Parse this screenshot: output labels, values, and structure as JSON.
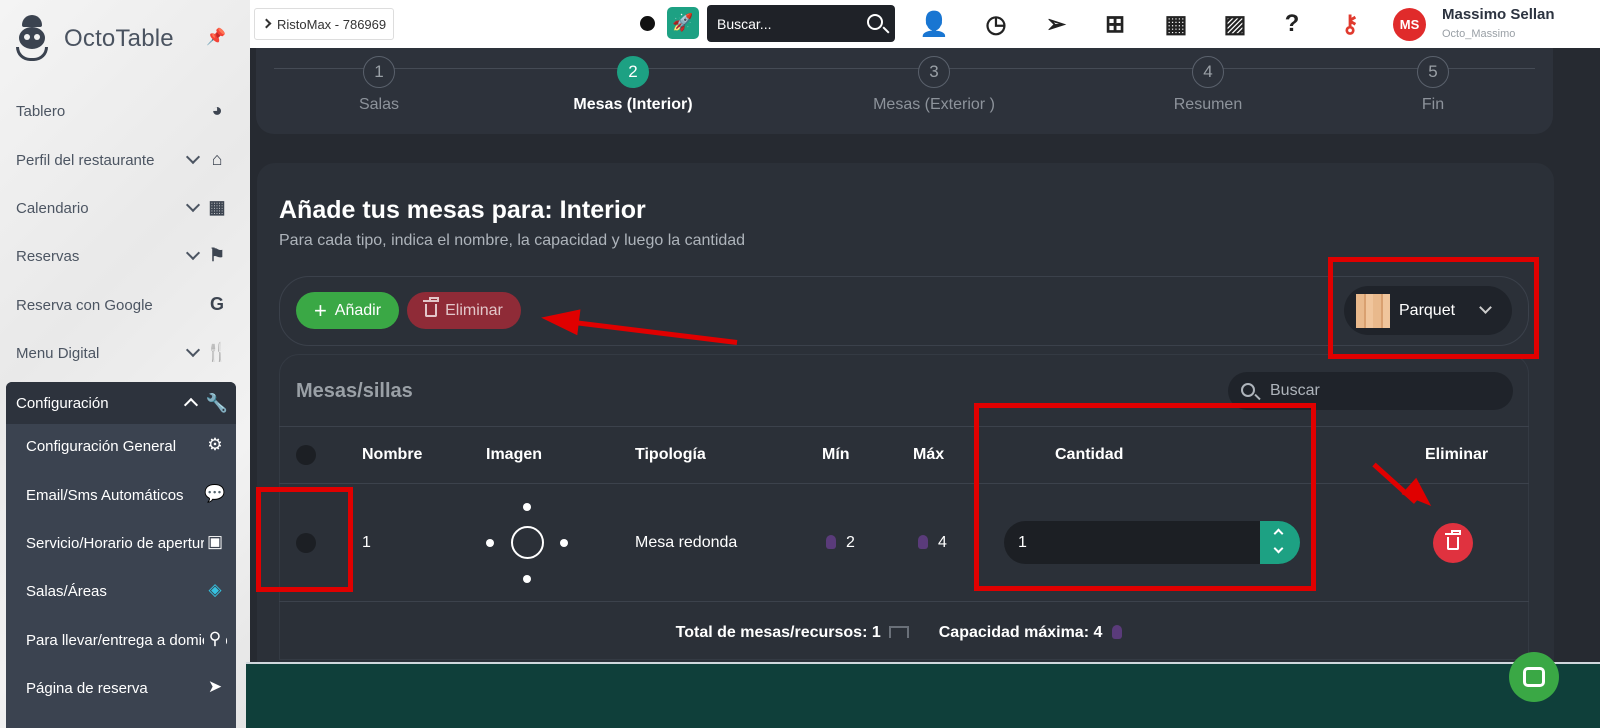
{
  "sidebar": {
    "brand": "OctoTable",
    "items": [
      {
        "label": "Tablero",
        "icon": "dashboard-icon"
      },
      {
        "label": "Perfil del restaurante",
        "icon": "home-icon"
      },
      {
        "label": "Calendario",
        "icon": "calendar-icon"
      },
      {
        "label": "Reservas",
        "icon": "flag-icon"
      },
      {
        "label": "Reserva con Google",
        "icon": "google-icon"
      },
      {
        "label": "Menu Digital",
        "icon": "fork-knife-icon"
      }
    ],
    "config": {
      "label": "Configuración",
      "items": [
        {
          "label": "Configuración General",
          "icon": "gear-icon"
        },
        {
          "label": "Email/Sms Automáticos",
          "icon": "chat-icon"
        },
        {
          "label": "Servicio/Horario de apertura",
          "icon": "calendar-check-icon"
        },
        {
          "label": "Salas/Áreas",
          "icon": "layers-icon"
        },
        {
          "label": "Para llevar/entrega a domicilio",
          "icon": "bike-icon"
        },
        {
          "label": "Página de reserva",
          "icon": "cursor-icon"
        }
      ]
    }
  },
  "topbar": {
    "restaurant": "RistoMax - 786969",
    "search_placeholder": "Buscar...",
    "user_name": "Massimo Sellan",
    "user_login": "Octo_Massimo",
    "avatar_initials": "MS",
    "icons": [
      "add-user-icon",
      "clock-icon",
      "send-icon",
      "sitemap-icon",
      "calendar-grid-icon",
      "gallery-icon",
      "help-icon",
      "key-icon"
    ]
  },
  "stepper": {
    "steps": [
      {
        "num": "1",
        "label": "Salas"
      },
      {
        "num": "2",
        "label": "Mesas (Interior)"
      },
      {
        "num": "3",
        "label": "Mesas (Exterior )"
      },
      {
        "num": "4",
        "label": "Resumen"
      },
      {
        "num": "5",
        "label": "Fin"
      }
    ],
    "active_step": 2
  },
  "main": {
    "title": "Añade tus mesas para: Interior",
    "subtitle": "Para cada tipo, indica el nombre, la capacidad y luego la cantidad",
    "add_label": "Añadir",
    "delete_label": "Eliminar",
    "floor": "Parquet",
    "panel_title": "Mesas/sillas",
    "search_placeholder": "Buscar",
    "columns": [
      "Nombre",
      "Imagen",
      "Tipología",
      "Mín",
      "Máx",
      "Cantidad",
      "Eliminar"
    ],
    "rows": [
      {
        "name": "1",
        "type": "Mesa redonda",
        "min": "2",
        "max": "4",
        "quantity": "1"
      }
    ],
    "total_label": "Total de mesas/recursos: 1",
    "capacity_label": "Capacidad máxima: 4"
  },
  "colors": {
    "accent": "#1da183",
    "add": "#3aa845",
    "danger": "#e0323f",
    "annotation": "#e00000"
  }
}
